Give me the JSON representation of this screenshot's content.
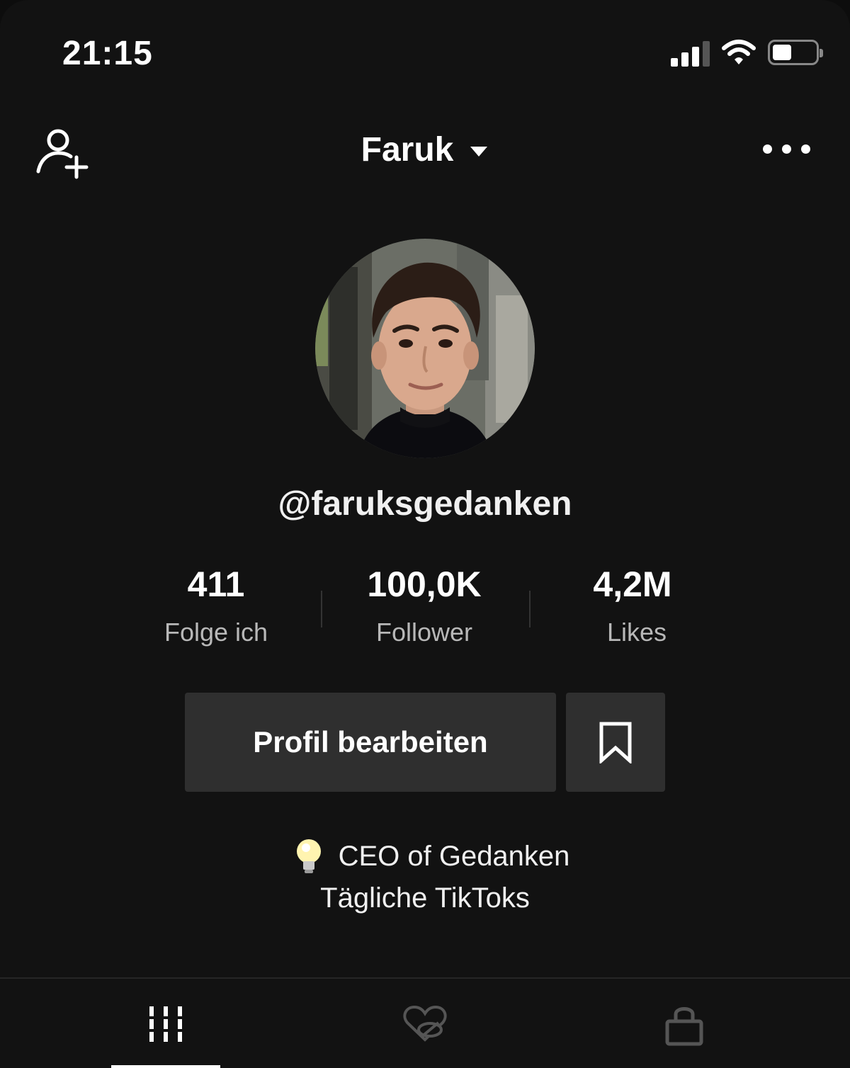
{
  "status_bar": {
    "time": "21:15",
    "icons": [
      "signal-icon",
      "wifi-icon",
      "battery-icon"
    ]
  },
  "header": {
    "title": "Faruk",
    "left_icon": "add-user-icon",
    "title_icon": "caret-down-icon",
    "right_icon": "more-icon"
  },
  "profile": {
    "username": "@faruksgedanken",
    "stats": [
      {
        "value": "411",
        "label": "Folge ich"
      },
      {
        "value": "100,0K",
        "label": "Follower"
      },
      {
        "value": "4,2M",
        "label": "Likes"
      }
    ],
    "edit_button": "Profil bearbeiten",
    "bookmark_icon": "bookmark-icon",
    "bio": {
      "emoji": "💡",
      "line1": "CEO of Gedanken",
      "line2": "Tägliche TikToks"
    }
  },
  "tabs": [
    {
      "icon": "grid-icon",
      "active": true
    },
    {
      "icon": "liked-hidden-icon",
      "active": false
    },
    {
      "icon": "lock-icon",
      "active": false
    }
  ],
  "colors": {
    "background": "#121212",
    "button": "#2f2f2f",
    "secondary_text": "#b8b8b8",
    "inactive_icon": "#555555"
  }
}
